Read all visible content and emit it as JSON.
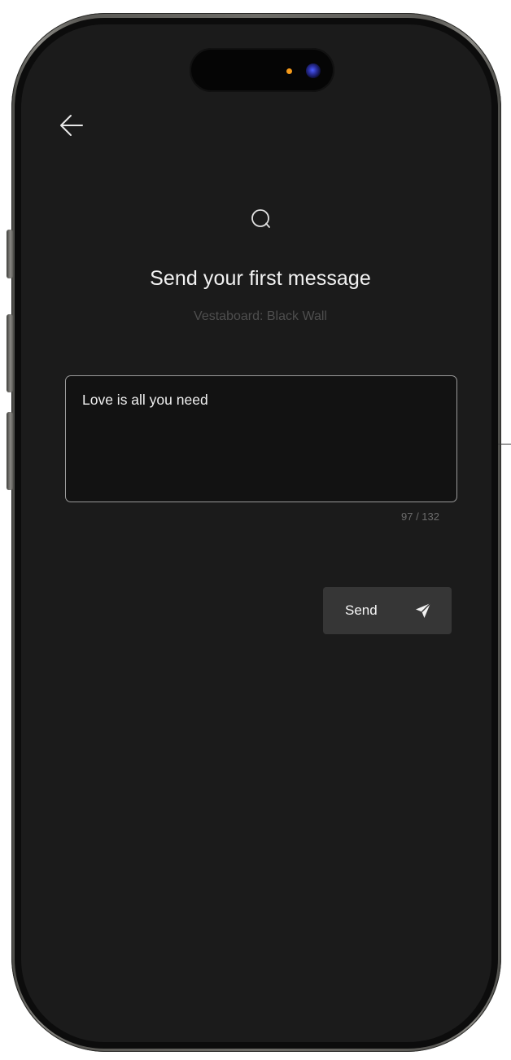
{
  "app": {
    "title": "Send your first message",
    "subtitle": "Vestaboard: Black Wall"
  },
  "message": {
    "value": "Love is all you need",
    "char_count": "97 / 132"
  },
  "actions": {
    "send_label": "Send"
  },
  "icons": {
    "back": "arrow-left-icon",
    "message": "chat-bubble-icon",
    "send": "paper-plane-icon"
  },
  "colors": {
    "screen_background": "#1b1b1b",
    "title_text": "#f2f2f2",
    "subtitle_text": "#4e4e4e",
    "send_button": "#363636",
    "camera_indicator": "#f59a1a"
  }
}
